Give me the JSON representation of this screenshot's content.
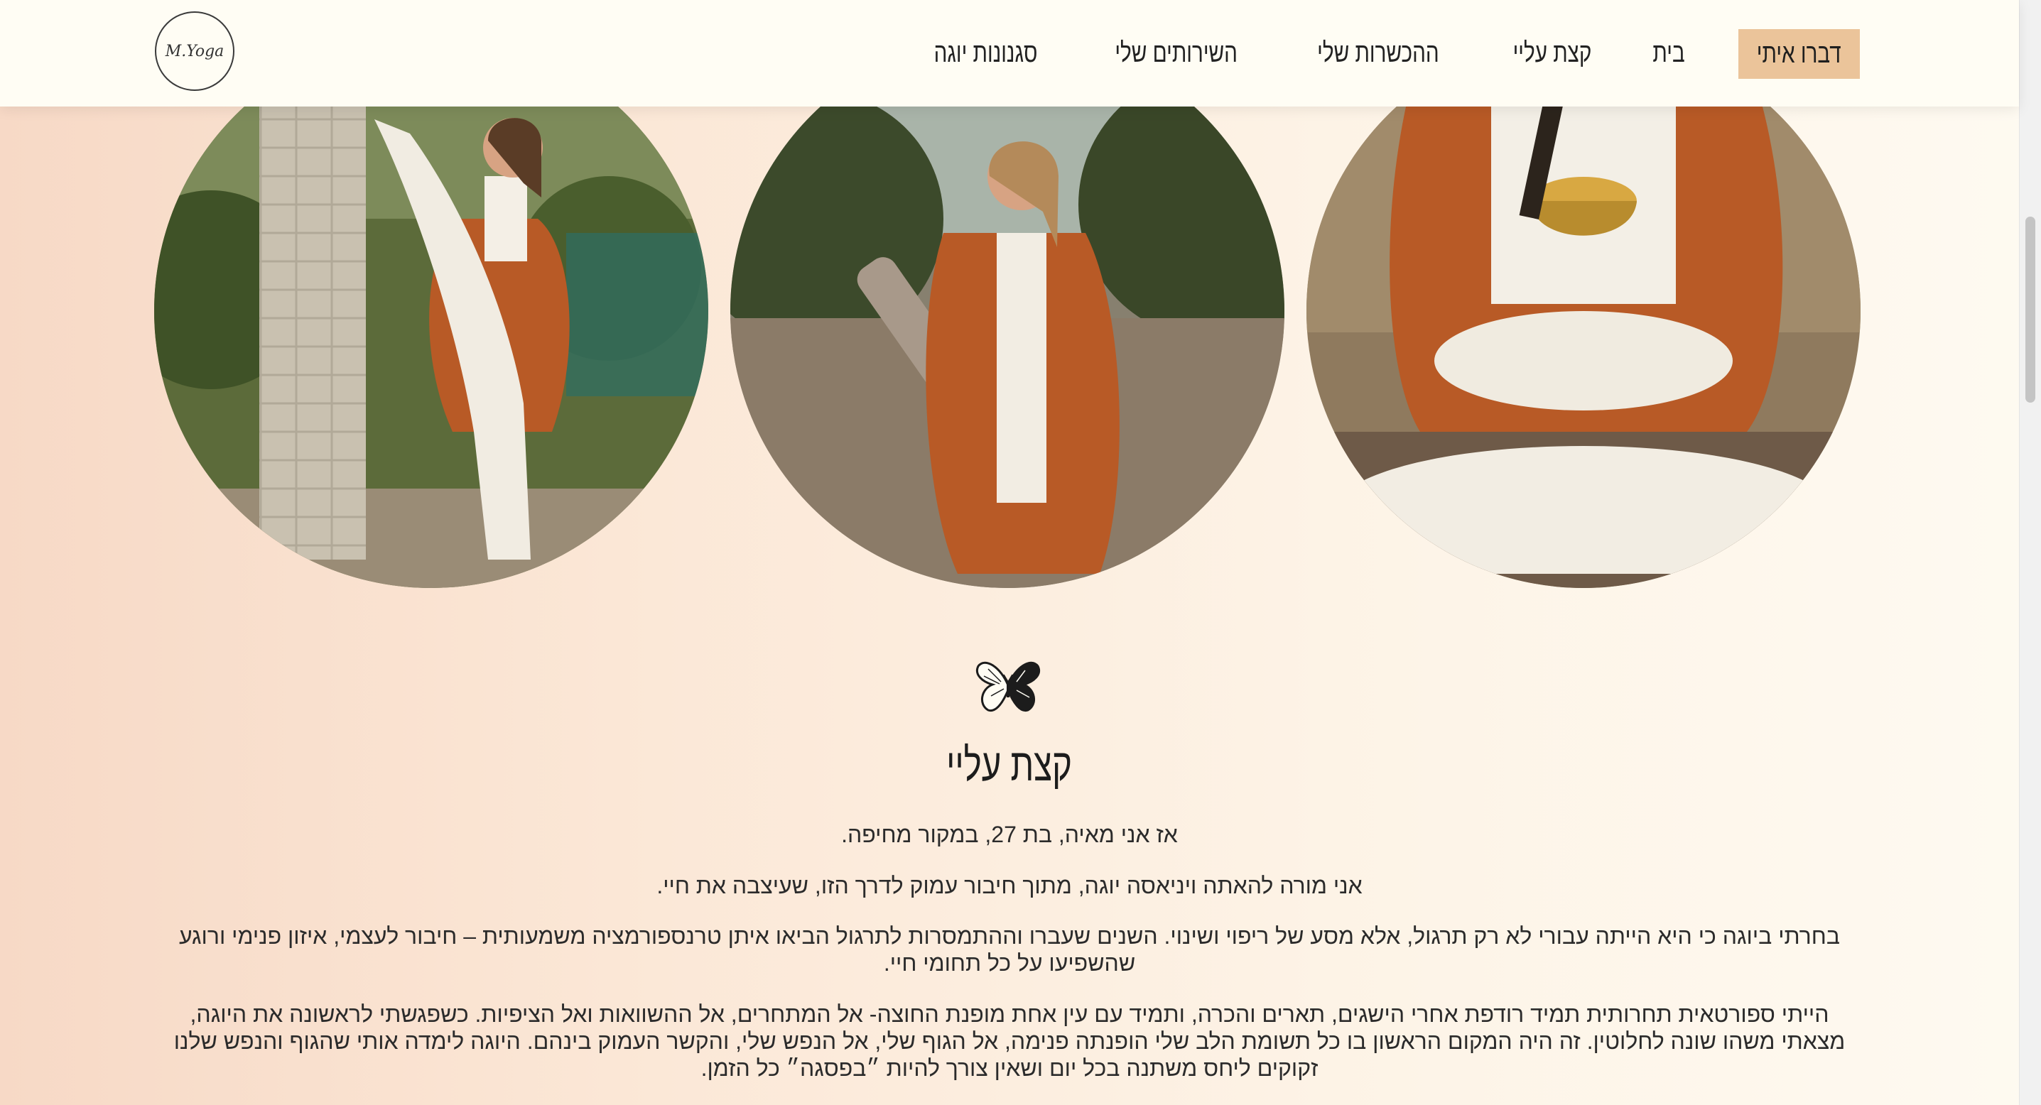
{
  "header": {
    "logo_text": "M.Yoga",
    "nav": [
      "סגנונות יוגה",
      "השירותים שלי",
      "ההכשרות שלי",
      "קצת עליי",
      "בית"
    ],
    "cta": "דברו איתי"
  },
  "section": {
    "title": "קצת עליי",
    "paragraphs": [
      "אז אני מאיה, בת 27, במקור מחיפה.",
      "אני מורה להאתה ויניאסה יוגה, מתוך חיבור עמוק לדרך הזו, שעיצבה את חיי.",
      "בחרתי ביוגה כי היא הייתה עבורי לא רק תרגול, אלא מסע של ריפוי ושינוי. השנים שעברו וההתמסרות לתרגול הביאו איתן טרנספורמציה משמעותית – חיבור לעצמי, איזון פנימי ורוגע שהשפיעו על כל תחומי חיי.",
      "הייתי ספורטאית תחרותית תמיד רודפת אחרי הישגים, תארים והכרה, ותמיד עם עין אחת מופנת החוצה- אל המתחרים, אל ההשוואות ואל הציפיות. כשפגשתי לראשונה את היוגה, מצאתי משהו שונה לחלוטין. זה היה המקום הראשון בו כל תשומת הלב שלי הופנתה פנימה, אל הגוף שלי, אל הנפש שלי, והקשר העמוק בינהם. היוגה לימדה אותי שהגוף והנפש שלנו זקוקים ליחס משתנה בכל יום ושאין צורך להיות ״בפסגה״ כל הזמן."
    ]
  },
  "icons": {
    "butterfly": "butterfly-icon"
  },
  "colors": {
    "header_bg": "#fffdf4",
    "cta_bg": "#ebc49a",
    "robe": "#b85a26"
  }
}
